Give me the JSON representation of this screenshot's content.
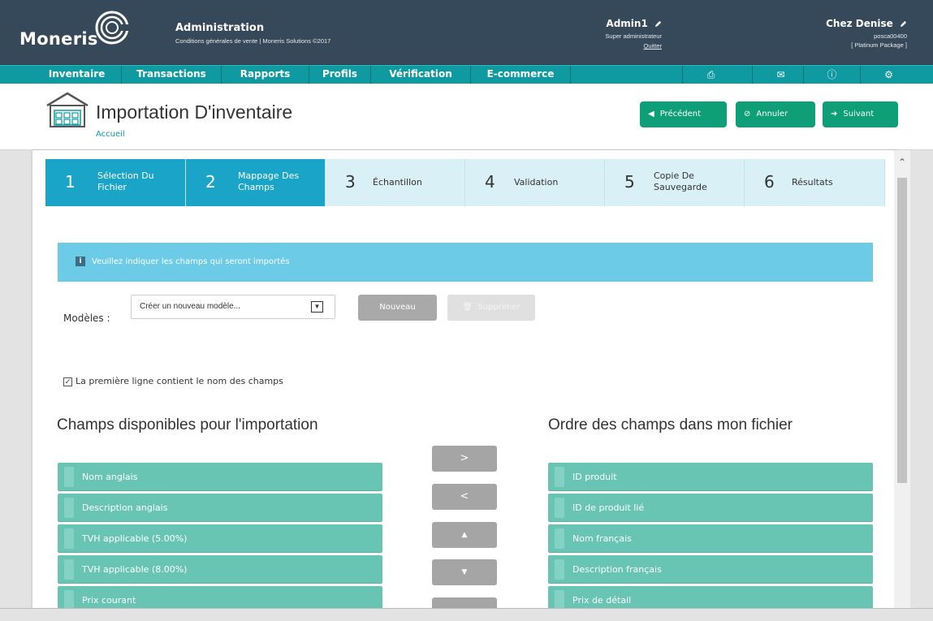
{
  "brand": {
    "name": "Moneris"
  },
  "header": {
    "title": "Administration",
    "subtitle": "Conditions générales de vente | Moneris Solutions ©2017",
    "user": {
      "name": "Admin1",
      "role": "Super administrateur",
      "logout": "Quitter"
    },
    "store": {
      "name": "Chez Denise",
      "id": "posca00400",
      "package": "[ Platinum Package ]"
    }
  },
  "nav": {
    "items": [
      "Inventaire",
      "Transactions",
      "Rapports",
      "Profils",
      "Vérification",
      "E-commerce"
    ],
    "icons": [
      "printer-icon",
      "mail-icon",
      "help-icon",
      "settings-icon"
    ]
  },
  "page": {
    "title": "Importation  D'inventaire",
    "breadcrumb": "Accueil",
    "buttons": {
      "previous": "Précédent",
      "cancel": "Annuler",
      "next": "Suivant"
    }
  },
  "wizard": {
    "steps": [
      {
        "num": "1",
        "label": "Sélection Du Fichier",
        "active": true
      },
      {
        "num": "2",
        "label": "Mappage Des Champs",
        "active": true
      },
      {
        "num": "3",
        "label": "Échantillon",
        "active": false
      },
      {
        "num": "4",
        "label": "Validation",
        "active": false
      },
      {
        "num": "5",
        "label": "Copie De Sauvegarde",
        "active": false
      },
      {
        "num": "6",
        "label": "Résultats",
        "active": false
      }
    ]
  },
  "info": {
    "text": "Veuillez indiquer les champs qui seront importés"
  },
  "models": {
    "label": "Modèles :",
    "selected": "Créer un nouveau modèle...",
    "new_button": "Nouveau",
    "delete_button": "Supprimer"
  },
  "options": {
    "first_row_header": "La première ligne contient le nom des champs",
    "checked": true
  },
  "available": {
    "title": "Champs disponibles pour l'importation",
    "items": [
      "Nom anglais",
      "Description anglais",
      "TVH applicable (5.00%)",
      "TVH applicable (8.00%)",
      "Prix courant"
    ]
  },
  "order": {
    "title": "Ordre des champs dans mon fichier",
    "items": [
      "ID produit",
      "ID de produit lié",
      "Nom français",
      "Description français",
      "Prix de détail"
    ]
  },
  "move_buttons": {
    "add": ">",
    "remove": "<",
    "up": "▲",
    "down": "▼",
    "all": ">>"
  },
  "colors": {
    "header": "#36495a",
    "nav": "#0e9aa0",
    "action": "#0e9e78",
    "step_active": "#1aa4c8",
    "step": "#d9f0f6",
    "info": "#6ccbe7",
    "list": "#68c5b4"
  }
}
